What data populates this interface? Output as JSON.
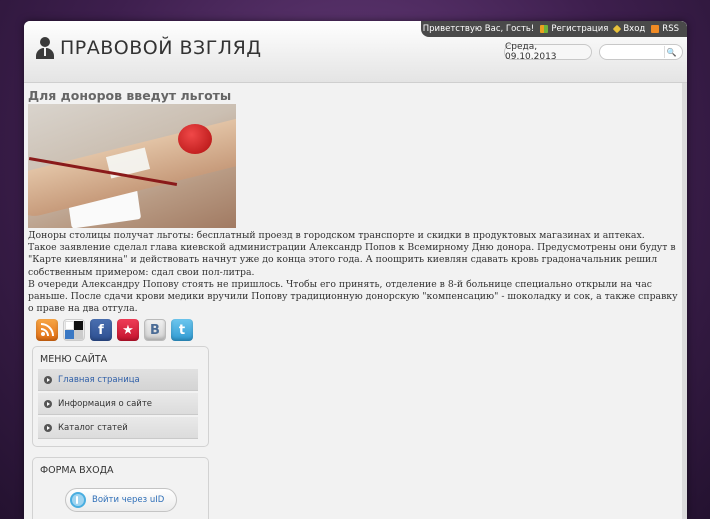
{
  "topbar": {
    "greeting": "Приветствую Вас, Гость!",
    "register": "Регистрация",
    "login": "Вход",
    "rss": "RSS"
  },
  "header": {
    "site_title": "ПРАВОВОЙ ВЗГЛЯД",
    "date": "Среда, 09.10.2013",
    "search_placeholder": "",
    "search_button": "🔍"
  },
  "article": {
    "title": "Для доноров введут льготы",
    "paragraphs": [
      " Доноры столицы получат льготы: бесплатный проезд в городском транспорте и скидки в продуктовых магазинах и аптеках.",
      "Такое заявление сделал глава киевской администрации Александр Попов к Всемирному Дню донора. Предусмотрены они будут в \"Карте киевлянина\" и действовать начнут уже до конца этого года. А поощрить киевлян сдавать кровь градоначальник решил собственным примером: сдал свои пол-литра.",
      "В очереди Александру Попову стоять не пришлось. Чтобы его принять, отделение в 8-й больнице специально открыли на час раньше. После сдачи крови медики вручили Попову традиционную донорскую \"компенсацию\" - шоколадку и сок, а также справку о праве на два отгула."
    ]
  },
  "social": {
    "rss": "",
    "delicious": "",
    "facebook": "f",
    "favorites": "★",
    "vkontakte": "B",
    "twitter": "t"
  },
  "site_menu": {
    "title": "МЕНЮ САЙТА",
    "items": [
      {
        "label": "Главная страница"
      },
      {
        "label": "Информация о сайте"
      },
      {
        "label": "Каталог статей"
      }
    ]
  },
  "login_form": {
    "title": "ФОРМА ВХОДА",
    "uid_button": "Войти через uID"
  },
  "colors": {
    "background": "#3e1f4e",
    "link": "#2f5fa8",
    "topbar": "#4a4a4a"
  }
}
